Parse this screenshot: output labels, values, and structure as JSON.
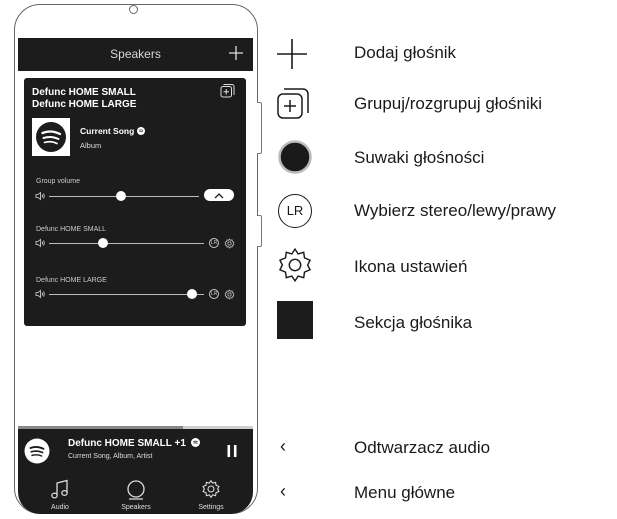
{
  "colors": {
    "dark": "#1c1c1c",
    "panel": "#1c1c1c",
    "white": "#ffffff"
  },
  "header": {
    "title": "Speakers",
    "add_icon": "plus-icon"
  },
  "card": {
    "speaker_names": [
      "Defunc HOME SMALL",
      "Defunc HOME LARGE"
    ],
    "group_icon": "group-icon",
    "song": "Current Song",
    "album": "Album",
    "group_volume_label": "Group volume",
    "group_volume": 0.48,
    "speakers": [
      {
        "label": "Defunc HOME SMALL",
        "volume": 0.35,
        "lr_text": "LR"
      },
      {
        "label": "Defunc HOME LARGE",
        "volume": 0.92,
        "lr_text": "LR"
      }
    ]
  },
  "player": {
    "title": "Defunc HOME SMALL +1",
    "subtitle": "Current Song, Album, Artist",
    "progress": 0.7
  },
  "nav": {
    "items": [
      {
        "label": "Audio",
        "icon": "music-icon"
      },
      {
        "label": "Speakers",
        "icon": "speaker-icon"
      },
      {
        "label": "Settings",
        "icon": "gear-icon"
      }
    ]
  },
  "legend": [
    {
      "icon": "plus-icon",
      "text": "Dodaj głośnik"
    },
    {
      "icon": "group-icon",
      "text": "Grupuj/rozgrupuj głośniki"
    },
    {
      "icon": "volume-slider-icon",
      "text": "Suwaki głośności"
    },
    {
      "icon": "lr-icon",
      "text": "Wybierz stereo/lewy/prawy",
      "icon_text": "LR"
    },
    {
      "icon": "gear-icon",
      "text": "Ikona ustawień"
    },
    {
      "icon": "speaker-section-icon",
      "text": "Sekcja głośnika"
    },
    {
      "icon": "chevron-left-icon",
      "text": "Odtwarzacz audio",
      "icon_text": "‹"
    },
    {
      "icon": "chevron-left-icon",
      "text": "Menu główne",
      "icon_text": "‹"
    }
  ]
}
